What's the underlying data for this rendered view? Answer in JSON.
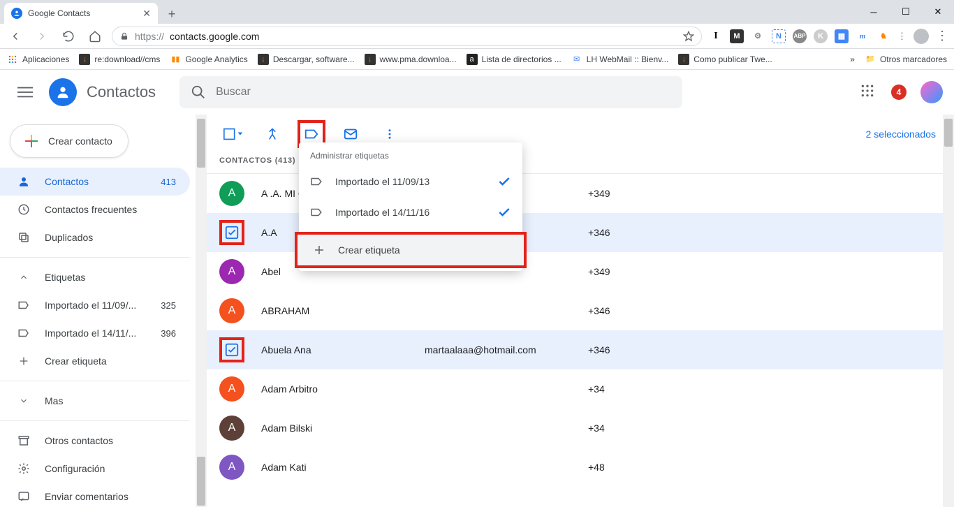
{
  "browser": {
    "tab_title": "Google Contacts",
    "url_scheme": "https://",
    "url_host": "contacts.google.com",
    "bookmarks_label": "Aplicaciones",
    "bookmarks": [
      "re:download//cms",
      "Google Analytics",
      "Descargar, software...",
      "www.pma.downloa...",
      "Lista de directorios ...",
      "LH WebMail :: Bienv...",
      "Como publicar Twe..."
    ],
    "bookmarks_overflow": "»",
    "other_bookmarks": "Otros marcadores"
  },
  "header": {
    "app_title": "Contactos",
    "search_placeholder": "Buscar",
    "badge_count": "4"
  },
  "sidebar": {
    "create_label": "Crear contacto",
    "items": [
      {
        "icon": "person",
        "label": "Contactos",
        "count": "413",
        "active": true
      },
      {
        "icon": "history",
        "label": "Contactos frecuentes"
      },
      {
        "icon": "copy",
        "label": "Duplicados"
      }
    ],
    "labels_header": "Etiquetas",
    "label_items": [
      {
        "label": "Importado el 11/09/...",
        "count": "325"
      },
      {
        "label": "Importado el 14/11/...",
        "count": "396"
      }
    ],
    "create_label_text": "Crear etiqueta",
    "more": "Mas",
    "other_contacts": "Otros contactos",
    "settings": "Configuración",
    "feedback": "Enviar comentarios"
  },
  "toolbar": {
    "selected_text": "2 seleccionados"
  },
  "labels_menu": {
    "title": "Administrar etiquetas",
    "items": [
      {
        "label": "Importado el 11/09/13",
        "checked": true
      },
      {
        "label": "Importado el 14/11/16",
        "checked": true
      }
    ],
    "create": "Crear etiqueta"
  },
  "contacts": {
    "section_label": "CONTACTOS (413)",
    "rows": [
      {
        "initial": "A",
        "color": "#0f9d58",
        "name": "A .A. MI C",
        "phone": "+349",
        "selected": false
      },
      {
        "initial": "",
        "color": "",
        "name": "A.A",
        "phone": "+346",
        "selected": true
      },
      {
        "initial": "A",
        "color": "#9c27b0",
        "name": "Abel",
        "phone": "+349",
        "selected": false
      },
      {
        "initial": "A",
        "color": "#f4511e",
        "name": "ABRAHAM",
        "phone": "+346",
        "selected": false
      },
      {
        "initial": "",
        "color": "",
        "name": "Abuela Ana",
        "email": "martaalaaa@hotmail.com",
        "phone": "+346",
        "selected": true
      },
      {
        "initial": "A",
        "color": "#f4511e",
        "name": "Adam Arbitro",
        "phone": "+34",
        "selected": false
      },
      {
        "initial": "A",
        "color": "#5d4037",
        "name": "Adam Bilski",
        "phone": "+34",
        "selected": false
      },
      {
        "initial": "A",
        "color": "#7e57c2",
        "name": "Adam Kati",
        "phone": "+48",
        "selected": false
      }
    ]
  }
}
